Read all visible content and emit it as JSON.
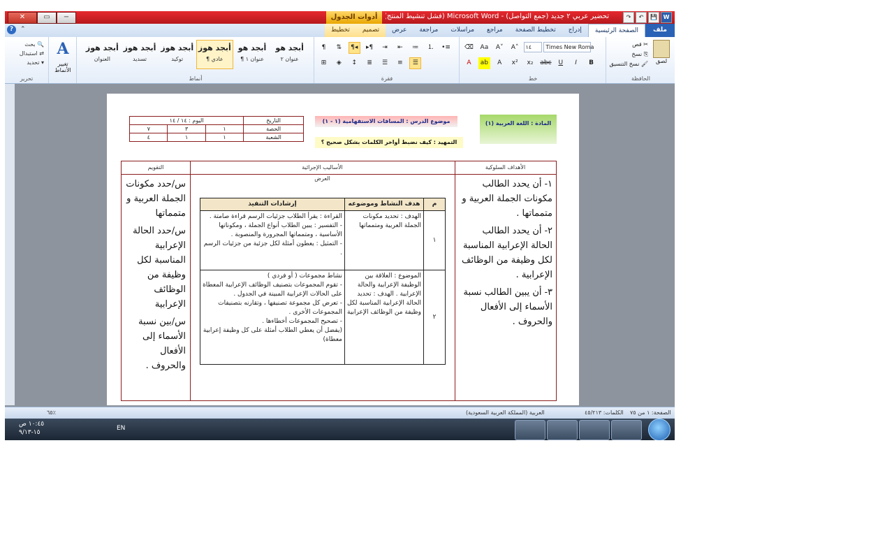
{
  "window": {
    "title": "تحضير عربي ٢ جديد (جمع التواصل) - Microsoft Word (فشل تنشيط المنتج)",
    "context_tab_group": "أدوات الجدول",
    "close_glyph": "✕",
    "maximize_glyph": "▭",
    "minimize_glyph": "−",
    "qat": {
      "save": "💾",
      "undo": "↶",
      "redo": "↷",
      "logo": "W"
    }
  },
  "tabs": [
    {
      "label": "ملف",
      "kind": "file"
    },
    {
      "label": "الصفحة الرئيسية",
      "kind": "active"
    },
    {
      "label": "إدراج",
      "kind": ""
    },
    {
      "label": "تخطيط الصفحة",
      "kind": ""
    },
    {
      "label": "مراجع",
      "kind": ""
    },
    {
      "label": "مراسلات",
      "kind": ""
    },
    {
      "label": "مراجعة",
      "kind": ""
    },
    {
      "label": "عرض",
      "kind": ""
    },
    {
      "label": "تصميم",
      "kind": "ctx"
    },
    {
      "label": "تخطيط",
      "kind": "ctx"
    }
  ],
  "ribbon": {
    "clipboard": {
      "label": "الحافظة",
      "paste": "لصق",
      "cut": "قص",
      "copy": "نسخ",
      "format_painter": "نسخ التنسيق"
    },
    "font": {
      "label": "خط",
      "name": "Times New Roma",
      "size": "١٤",
      "bold": "B",
      "italic": "I",
      "underline": "U",
      "strike": "abc",
      "sub": "x₂",
      "sup": "x²",
      "grow": "A˄",
      "shrink": "A˅",
      "case": "Aa"
    },
    "paragraph": {
      "label": "فقرة"
    },
    "styles": {
      "label": "أنماط",
      "items": [
        {
          "sample": "أبجد هوز",
          "name": "العنوان"
        },
        {
          "sample": "أبجد هوز",
          "name": "تسديد"
        },
        {
          "sample": "أبجد هوز",
          "name": "توكيد"
        },
        {
          "sample": "أبجد هوز",
          "name": "¶ عادي"
        },
        {
          "sample": "أبجد هو",
          "name": "¶ عنوان ١"
        },
        {
          "sample": "أبجد هو",
          "name": "عنوان ٢"
        }
      ],
      "change_styles": "تغيير الأنماط"
    },
    "editing": {
      "label": "تحرير",
      "find": "بحث",
      "replace": "استبدال",
      "select": "تحديد"
    }
  },
  "document": {
    "subject_box": "المادة : اللغة العربية (١)",
    "lesson_box": "موضوع الدرس : المسافات الاستفهامية (١ - ١)",
    "warmup_box": "التمهيد : كيف نضبط أواخر الكلمات بشكل صحيح ؟",
    "date_table": {
      "rows": [
        [
          "التاريخ",
          "اليوم : ١٤ / ١٤"
        ],
        [
          "الحصة",
          "١",
          "٣",
          "٧"
        ],
        [
          "الشعبة",
          "١",
          "١",
          "٤"
        ]
      ]
    },
    "headers": {
      "objectives": "الأهداف السلوكية",
      "procedures": "الأساليب الإجرائية",
      "evaluation": "التقويم",
      "presentation": "العرض"
    },
    "objectives_text": [
      "١- أن يحدد الطالب مكونات الجملة العربية و متمماتها .",
      "٢- أن يحدد الطالب الحالة الإعرابية المناسبة لكل وظيفة من الوظائف الإعرابية .",
      "٣- أن يبين الطالب نسبة الأسماء إلى الأفعال والحروف ."
    ],
    "evaluation_text": [
      "س/حدد مكونات الجملة العربية و متمماتها",
      "س/حدد الحالة الإعرابية المناسبة لكل وظيفة من الوظائف الإعرابية",
      "س/بين نسبة الأسماء إلى الأفعال والحروف ."
    ],
    "inner_table": {
      "headers": [
        "م",
        "هدف النشاط وموضوعه",
        "إرشادات التنفيذ"
      ],
      "rows": [
        {
          "num": "١",
          "goal": "الهدف : تحديد مكونات الجملة العربية ومتمماتها",
          "steps": [
            "القراءة : يقرأ الطلاب جزئيات الرسم قراءة صامتة .",
            "- التفسير : يبين الطلاب أنواع الجملة ، ومكوناتها الأساسية ، ومتمماتها المجرورة والمنصوبة .",
            "- التمثيل : يعطون أمثلة لكل جزئية من جزئيات الرسم ."
          ]
        },
        {
          "num": "٢",
          "goal": "الموضوع : العلاقة بين الوظيفة الإعرابية والحالة الإعرابية . الهدف : تحديد الحالة الإعرابية المناسبة لكل وظيفة من الوظائف الإعرابية",
          "steps": [
            "نشاط مجموعات ( أو فردي )",
            "- تقوم المجموعات بتصنيف الوظائف الإعرابية المعطاة على الحالات الإعرابية المبينة في الجدول .",
            "- تعرض كل مجموعة تصنيفها ، وتقارنه بتصنيفات المجموعات الأخرى .",
            "- تصحيح المجموعات أخطاءها .",
            "(يفضل أن يعطي الطلاب أمثلة على كل وظيفة إعرابية معطاة)"
          ]
        }
      ]
    }
  },
  "statusbar": {
    "page": "الصفحة: ١ من ٧٥",
    "words": "الكلمات: ٤٥/٢١٣",
    "language": "العربية (المملكة العربية السعودية)",
    "zoom": "٦٥٪"
  },
  "taskbar": {
    "time": "١٠:٤٥ ص",
    "date": "١٥-٩/١٣",
    "lang": "EN"
  }
}
